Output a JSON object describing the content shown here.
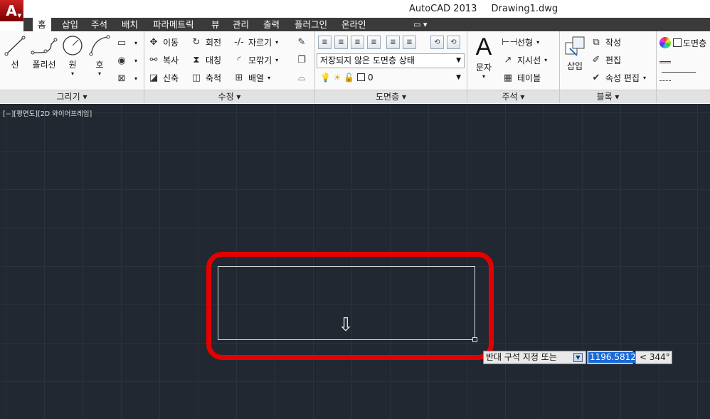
{
  "app": {
    "title": "AutoCAD 2013",
    "document": "Drawing1.dwg",
    "logo": "A"
  },
  "tabs": [
    "홈",
    "삽입",
    "주석",
    "배치",
    "파라메트릭",
    "뷰",
    "관리",
    "출력",
    "플러그인",
    "온라인"
  ],
  "active_tab": "홈",
  "panels": {
    "draw": {
      "title": "그리기 ▾",
      "tools": {
        "line": "선",
        "polyline": "폴리선",
        "circle": "원",
        "arc": "호"
      }
    },
    "modify": {
      "title": "수정 ▾",
      "tools": {
        "move": "이동",
        "rotate": "회전",
        "trim": "자르기",
        "copy": "복사",
        "mirror": "대칭",
        "fillet": "모깎기",
        "stretch": "신축",
        "scale": "축척",
        "array": "배열"
      }
    },
    "layers": {
      "title": "도면층 ▾",
      "layer_state": "저장되지 않은 도면층 상태",
      "current_layer": "0"
    },
    "annotation": {
      "title": "주석 ▾",
      "text": "문자",
      "linear": "선형",
      "leader": "지시선",
      "table": "테이블"
    },
    "block": {
      "title": "블록 ▾",
      "insert": "삽입",
      "create": "작성",
      "edit": "편집",
      "attr_edit": "속성 편집"
    },
    "properties": {
      "layer_label": "도면층"
    }
  },
  "viewport": {
    "label": "[−][평면도][2D 와이어프레임]",
    "prompt": "반대 구석 지정 또는",
    "input_value": "1196.5812",
    "angle": "< 344°"
  },
  "colors": {
    "viewport_bg": "#212832",
    "highlight": "#e30000",
    "tabbar": "#3a3a3a",
    "input_selection": "#1a6ad8"
  }
}
